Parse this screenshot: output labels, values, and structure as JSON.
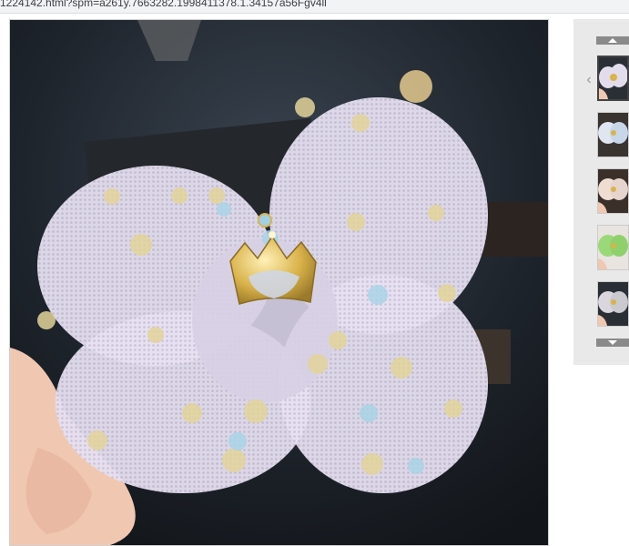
{
  "browser": {
    "url_fragment": "1224142.html?spm=a261y.7663282.1998411378.1.34157a56Fgv4ll"
  },
  "gallery": {
    "main_image_alt": "",
    "thumbnails": [
      {
        "name": "thumb-lavender-bow",
        "active": true,
        "color": "#d9d4e6"
      },
      {
        "name": "thumb-white-blue-bow",
        "active": false,
        "color": "#c8d6ea"
      },
      {
        "name": "thumb-pink-bow",
        "active": false,
        "color": "#e8d4cf"
      },
      {
        "name": "thumb-green-bow",
        "active": false,
        "color": "#9bd87a"
      },
      {
        "name": "thumb-gray-bow",
        "active": false,
        "color": "#c9c9cf"
      }
    ]
  },
  "colors": {
    "background": "#1d2229",
    "tulle": "#e4def0",
    "crown_gold": "#d8b44a",
    "panel": "#e9e9e9"
  },
  "icons": {
    "scroll_up": "triangle-up-icon",
    "scroll_down": "triangle-down-icon",
    "prev": "chevron-left-icon"
  }
}
